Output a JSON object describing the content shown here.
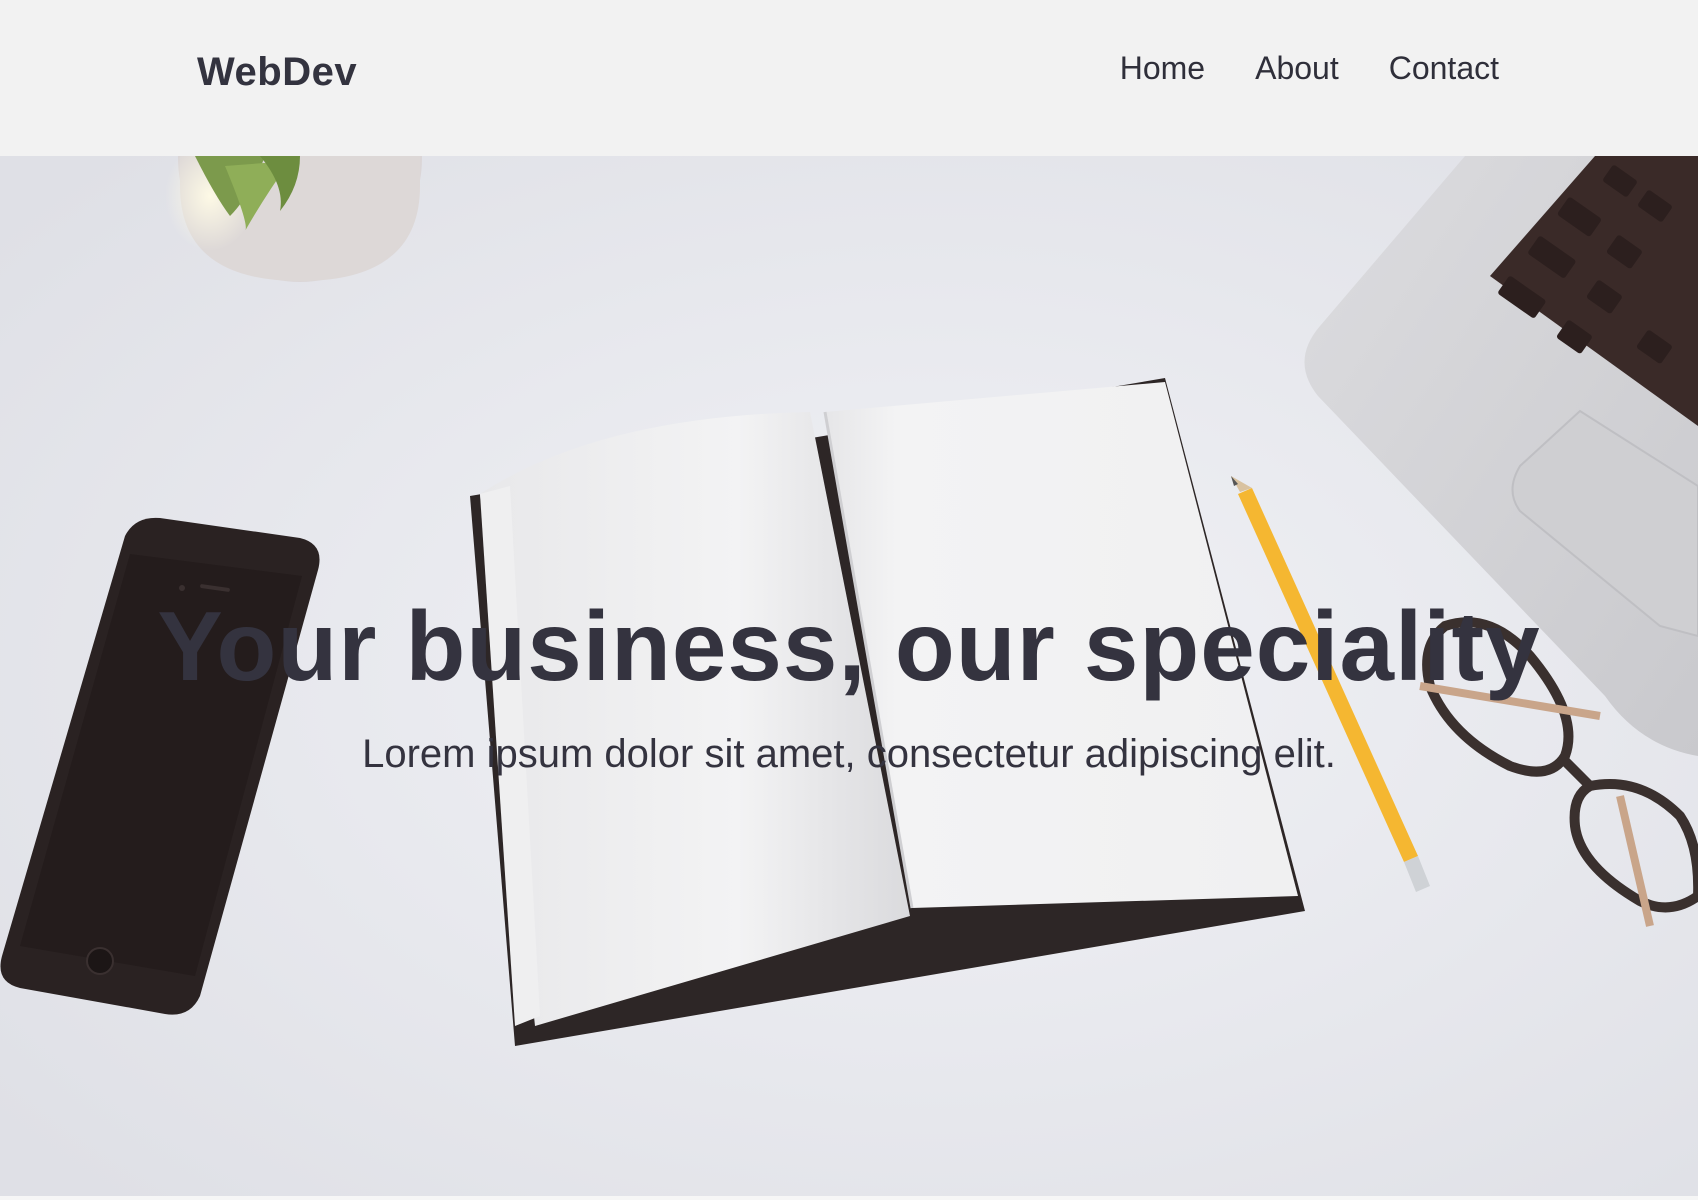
{
  "header": {
    "logo": "WebDev",
    "nav": [
      {
        "label": "Home"
      },
      {
        "label": "About"
      },
      {
        "label": "Contact"
      }
    ]
  },
  "hero": {
    "headline": "Your business, our speciality",
    "subheadline": "Lorem ipsum dolor sit amet, consectetur adipiscing elit."
  },
  "colors": {
    "header_bg": "#f2f2f2",
    "text": "#34333f",
    "pencil": "#f5b731"
  }
}
